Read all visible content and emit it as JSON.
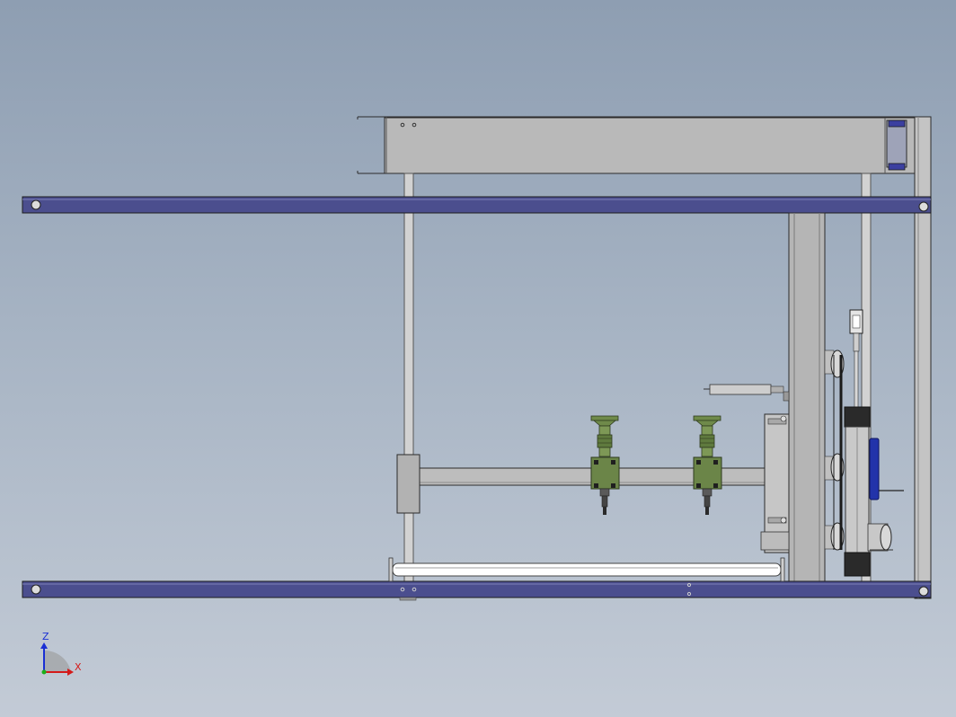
{
  "viewport": {
    "background_top": "#8e9eb2",
    "background_bottom": "#c3cbd6"
  },
  "colors": {
    "frame_rail": "#4a4d8c",
    "steel": "#bfbfbf",
    "steel_dark": "#8f8f8f",
    "rod": "#d4d4d4",
    "gearbox_green": "#6f8a4a",
    "motor_blue": "#2233aa",
    "outline": "#2b2b2b"
  },
  "triad": {
    "z_label": "Z",
    "x_label": "X",
    "z_color": "#1a2fd4",
    "x_color": "#d41a1a",
    "y_color": "#1ab01a"
  }
}
